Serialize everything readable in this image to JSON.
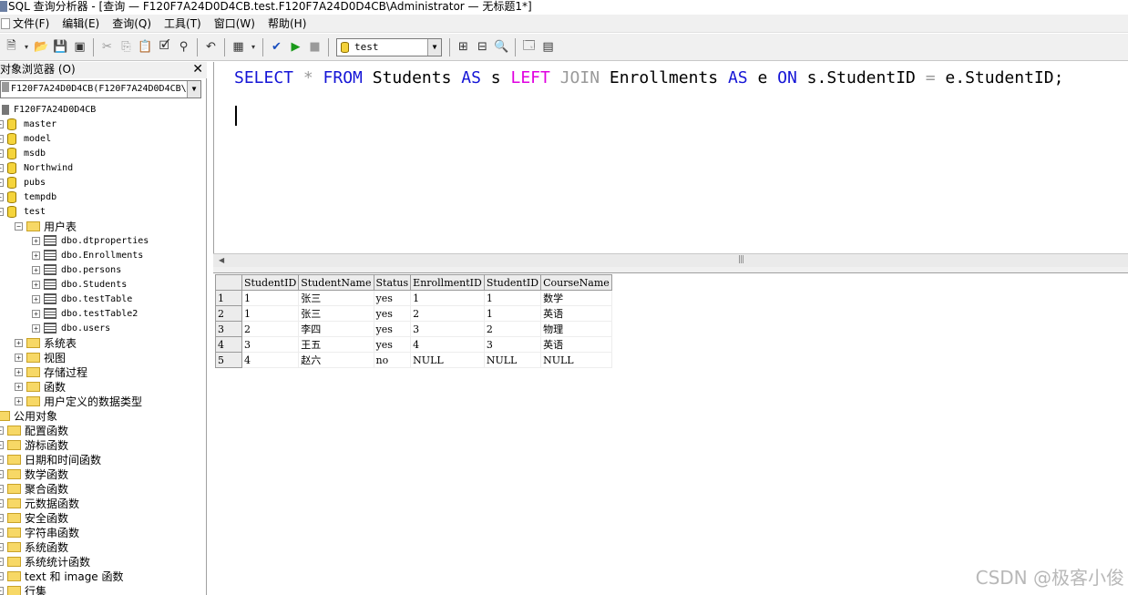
{
  "window": {
    "title": "SQL 查询分析器 - [查询 — F120F7A24D0D4CB.test.F120F7A24D0D4CB\\Administrator — 无标题1*]"
  },
  "menu": [
    "文件(F)",
    "编辑(E)",
    "查询(Q)",
    "工具(T)",
    "窗口(W)",
    "帮助(H)"
  ],
  "toolbar": {
    "database": "test"
  },
  "object_browser": {
    "title": "对象浏览器 (O)",
    "server_combo": "F120F7A24D0D4CB(F120F7A24D0D4CB\\",
    "server": "F120F7A24D0D4CB",
    "databases": [
      "master",
      "model",
      "msdb",
      "Northwind",
      "pubs",
      "tempdb",
      "test"
    ],
    "user_tables_folder": "用户表",
    "tables": [
      "dbo.dtproperties",
      "dbo.Enrollments",
      "dbo.persons",
      "dbo.Students",
      "dbo.testTable",
      "dbo.testTable2",
      "dbo.users"
    ],
    "test_folders": [
      "系统表",
      "视图",
      "存储过程",
      "函数",
      "用户定义的数据类型"
    ],
    "common_objects": "公用对象",
    "function_folders": [
      "配置函数",
      "游标函数",
      "日期和时间函数",
      "数学函数",
      "聚合函数",
      "元数据函数",
      "安全函数",
      "字符串函数",
      "系统函数",
      "系统统计函数",
      "text 和 image 函数",
      "行集"
    ]
  },
  "editor": {
    "tokens": [
      {
        "text": "SELECT",
        "style": "kw"
      },
      {
        "text": " * ",
        "style": "gr"
      },
      {
        "text": "FROM",
        "style": "kw"
      },
      {
        "text": " Students ",
        "style": ""
      },
      {
        "text": "AS",
        "style": "kw"
      },
      {
        "text": " s ",
        "style": ""
      },
      {
        "text": "LEFT",
        "style": "pk"
      },
      {
        "text": " ",
        "style": ""
      },
      {
        "text": "JOIN",
        "style": "gr"
      },
      {
        "text": " Enrollments ",
        "style": ""
      },
      {
        "text": "AS",
        "style": "kw"
      },
      {
        "text": " e ",
        "style": ""
      },
      {
        "text": "ON",
        "style": "kw"
      },
      {
        "text": " s.StudentID ",
        "style": ""
      },
      {
        "text": "=",
        "style": "gr"
      },
      {
        "text": " e.StudentID;",
        "style": ""
      }
    ]
  },
  "results": {
    "columns": [
      "StudentID",
      "StudentName",
      "Status",
      "EnrollmentID",
      "StudentID",
      "CourseName"
    ],
    "rows": [
      {
        "n": "1",
        "cells": [
          "1",
          "张三",
          "yes",
          "1",
          "1",
          "数学"
        ]
      },
      {
        "n": "2",
        "cells": [
          "1",
          "张三",
          "yes",
          "2",
          "1",
          "英语"
        ]
      },
      {
        "n": "3",
        "cells": [
          "2",
          "李四",
          "yes",
          "3",
          "2",
          "物理"
        ]
      },
      {
        "n": "4",
        "cells": [
          "3",
          "王五",
          "yes",
          "4",
          "3",
          "英语"
        ]
      },
      {
        "n": "5",
        "cells": [
          "4",
          "赵六",
          "no",
          "NULL",
          "NULL",
          "NULL"
        ]
      }
    ]
  },
  "watermark": "CSDN @极客小俊"
}
